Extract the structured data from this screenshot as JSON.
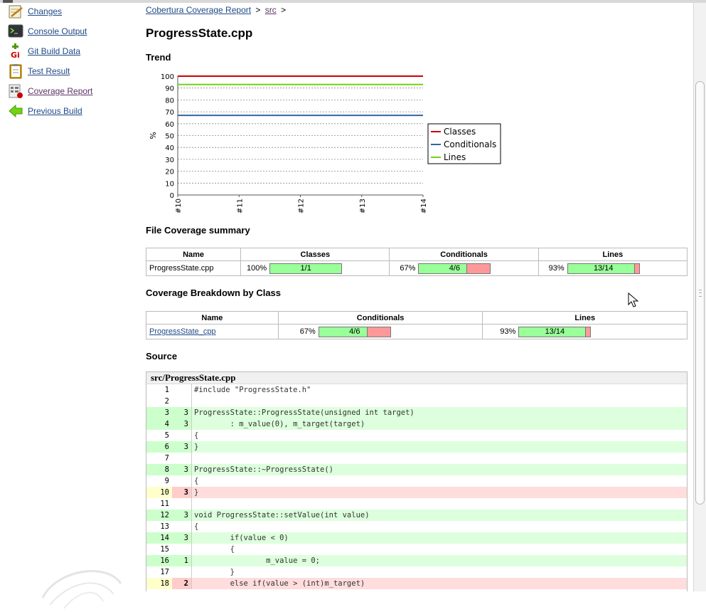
{
  "sidebar": {
    "items": [
      {
        "label": "Changes",
        "icon": "notepad-pencil-icon"
      },
      {
        "label": "Console Output",
        "icon": "terminal-icon"
      },
      {
        "label": "Git Build Data",
        "icon": "git-icon"
      },
      {
        "label": "Test Result",
        "icon": "clipboard-icon"
      },
      {
        "label": "Coverage Report",
        "icon": "coverage-report-icon"
      },
      {
        "label": "Previous Build",
        "icon": "back-arrow-icon"
      }
    ]
  },
  "breadcrumb": {
    "root": "Cobertura Coverage Report",
    "sep1": ">",
    "dir": "src",
    "sep2": ">"
  },
  "page_title": "ProgressState.cpp",
  "sections": {
    "trend": "Trend",
    "file_summary": "File Coverage summary",
    "breakdown": "Coverage Breakdown by Class",
    "source": "Source"
  },
  "chart_data": {
    "type": "line",
    "x": [
      "#10",
      "#11",
      "#12",
      "#13",
      "#14"
    ],
    "ylabel": "%",
    "ylim": [
      0,
      100
    ],
    "yticks": [
      0,
      10,
      20,
      30,
      40,
      50,
      60,
      70,
      80,
      90,
      100
    ],
    "grid": true,
    "legend_position": "right",
    "series": [
      {
        "name": "Classes",
        "color": "#cc0000",
        "values": [
          100,
          100,
          100,
          100,
          100
        ]
      },
      {
        "name": "Conditionals",
        "color": "#3465a4",
        "values": [
          67,
          67,
          67,
          67,
          67
        ]
      },
      {
        "name": "Lines",
        "color": "#73d216",
        "values": [
          93,
          93,
          93,
          93,
          93
        ]
      }
    ]
  },
  "file_summary": {
    "headers": [
      "Name",
      "Classes",
      "Conditionals",
      "Lines"
    ],
    "row": {
      "name": "ProgressState.cpp",
      "classes": {
        "pct": "100%",
        "label": "1/1",
        "ratio": 1.0
      },
      "conditionals": {
        "pct": "67%",
        "label": "4/6",
        "ratio": 0.6667
      },
      "lines": {
        "pct": "93%",
        "label": "13/14",
        "ratio": 0.9286
      }
    }
  },
  "breakdown": {
    "headers": [
      "Name",
      "Conditionals",
      "Lines"
    ],
    "row": {
      "name": "ProgressState_cpp",
      "conditionals": {
        "pct": "67%",
        "label": "4/6",
        "ratio": 0.6667
      },
      "lines": {
        "pct": "93%",
        "label": "13/14",
        "ratio": 0.9286
      }
    }
  },
  "source": {
    "file": "src/ProgressState.cpp",
    "lines": [
      {
        "n": "1",
        "hits": "",
        "code": "#include \"ProgressState.h\"",
        "state": "none"
      },
      {
        "n": "2",
        "hits": "",
        "code": "",
        "state": "none"
      },
      {
        "n": "3",
        "hits": "3",
        "code": "ProgressState::ProgressState(unsigned int target)",
        "state": "cov"
      },
      {
        "n": "4",
        "hits": "3",
        "code": "        : m_value(0), m_target(target)",
        "state": "cov"
      },
      {
        "n": "5",
        "hits": "",
        "code": "{",
        "state": "none"
      },
      {
        "n": "6",
        "hits": "3",
        "code": "}",
        "state": "cov"
      },
      {
        "n": "7",
        "hits": "",
        "code": "",
        "state": "none"
      },
      {
        "n": "8",
        "hits": "3",
        "code": "ProgressState::~ProgressState()",
        "state": "cov"
      },
      {
        "n": "9",
        "hits": "",
        "code": "{",
        "state": "none"
      },
      {
        "n": "10",
        "hits": "3",
        "code": "}",
        "state": "unc"
      },
      {
        "n": "11",
        "hits": "",
        "code": "",
        "state": "none"
      },
      {
        "n": "12",
        "hits": "3",
        "code": "void ProgressState::setValue(int value)",
        "state": "cov"
      },
      {
        "n": "13",
        "hits": "",
        "code": "{",
        "state": "none"
      },
      {
        "n": "14",
        "hits": "3",
        "code": "        if(value < 0)",
        "state": "cov"
      },
      {
        "n": "15",
        "hits": "",
        "code": "        {",
        "state": "none"
      },
      {
        "n": "16",
        "hits": "1",
        "code": "                m_value = 0;",
        "state": "cov"
      },
      {
        "n": "17",
        "hits": "",
        "code": "        }",
        "state": "none"
      },
      {
        "n": "18",
        "hits": "2",
        "code": "        else if(value > (int)m_target)",
        "state": "unc"
      }
    ]
  }
}
